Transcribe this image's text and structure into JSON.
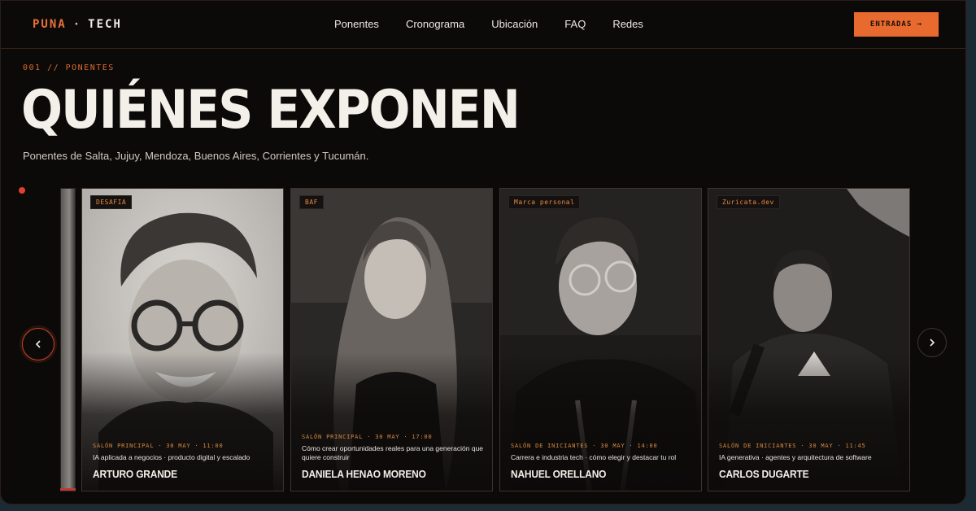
{
  "brand": {
    "left": "PUNA",
    "separator": "·",
    "right": "TECH"
  },
  "nav": {
    "links": [
      "Ponentes",
      "Cronograma",
      "Ubicación",
      "FAQ",
      "Redes"
    ],
    "cta": "ENTRADAS →"
  },
  "header": {
    "eyebrow": "001 // PONENTES",
    "title": "QUIÉNES EXPONEN",
    "subtitle": "Ponentes de Salta, Jujuy, Mendoza, Buenos Aires, Corrientes y Tucumán."
  },
  "speakers": [
    {
      "tag": "DESAFIA",
      "meta": "SALÓN PRINCIPAL · 30 MAY · 11:00",
      "topic": "IA aplicada a negocios · producto digital y escalado",
      "name": "ARTURO GRANDE"
    },
    {
      "tag": "BAF",
      "meta": "SALÓN PRINCIPAL · 30 MAY · 17:00",
      "topic": "Cómo crear oportunidades reales para una generación que quiere construir",
      "name": "DANIELA HENAO MORENO"
    },
    {
      "tag": "Marca personal",
      "meta": "SALÓN DE INICIANTES · 30 MAY · 14:00",
      "topic": "Carrera e industria tech · cómo elegir y destacar tu rol",
      "name": "NAHUEL ORELLANO"
    },
    {
      "tag": "Zuricata.dev",
      "meta": "SALÓN DE INICIANTES · 30 MAY · 11:45",
      "topic": "IA generativa · agentes y arquitectura de software",
      "name": "CARLOS DUGARTE"
    }
  ],
  "icons": {
    "prev": "chevron-left-icon",
    "next": "chevron-right-icon"
  },
  "colors": {
    "accent": "#e96a2e",
    "background": "#0c0a09",
    "indicator": "#e2402f"
  }
}
